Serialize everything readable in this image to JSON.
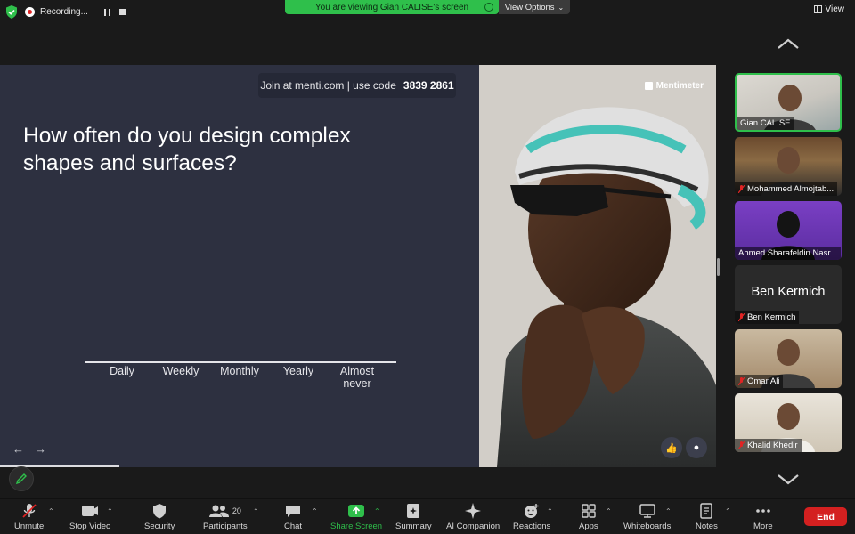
{
  "top": {
    "recording_label": "Recording...",
    "viewing_text": "You are viewing Gian CALISE's screen",
    "view_options_label": "View Options",
    "view_label": "View"
  },
  "slide": {
    "join_text": "Join at menti.com | use code",
    "join_code": "3839 2861",
    "question_line1": "How often do you design complex",
    "question_line2": "shapes and surfaces?",
    "brand": "Mentimeter"
  },
  "chart_data": {
    "type": "bar",
    "categories": [
      "Daily",
      "Weekly",
      "Monthly",
      "Yearly",
      "Almost never"
    ],
    "values": [
      0,
      0,
      0,
      0,
      0
    ]
  },
  "participants": [
    {
      "name": "Gian CALISE",
      "muted": false,
      "active": true
    },
    {
      "name": "Mohammed Almojtab...",
      "muted": true,
      "active": false
    },
    {
      "name": "Ahmed Sharafeldin Nasr...",
      "muted": false,
      "active": false
    },
    {
      "name": "Ben Kermich",
      "muted": true,
      "active": false,
      "display_name": "Ben Kermich"
    },
    {
      "name": "Omar Ali",
      "muted": true,
      "active": false
    },
    {
      "name": "Khalid Khedir",
      "muted": true,
      "active": false
    }
  ],
  "toolbar": {
    "unmute": "Unmute",
    "stop_video": "Stop Video",
    "security": "Security",
    "participants": "Participants",
    "participants_count": "20",
    "chat": "Chat",
    "share_screen": "Share Screen",
    "summary": "Summary",
    "ai_companion": "AI Companion",
    "reactions": "Reactions",
    "apps": "Apps",
    "whiteboards": "Whiteboards",
    "notes": "Notes",
    "more": "More",
    "end": "End"
  },
  "colors": {
    "accent_green": "#2fbf4b",
    "end_red": "#d42020",
    "slide_bg": "#2d3040"
  }
}
